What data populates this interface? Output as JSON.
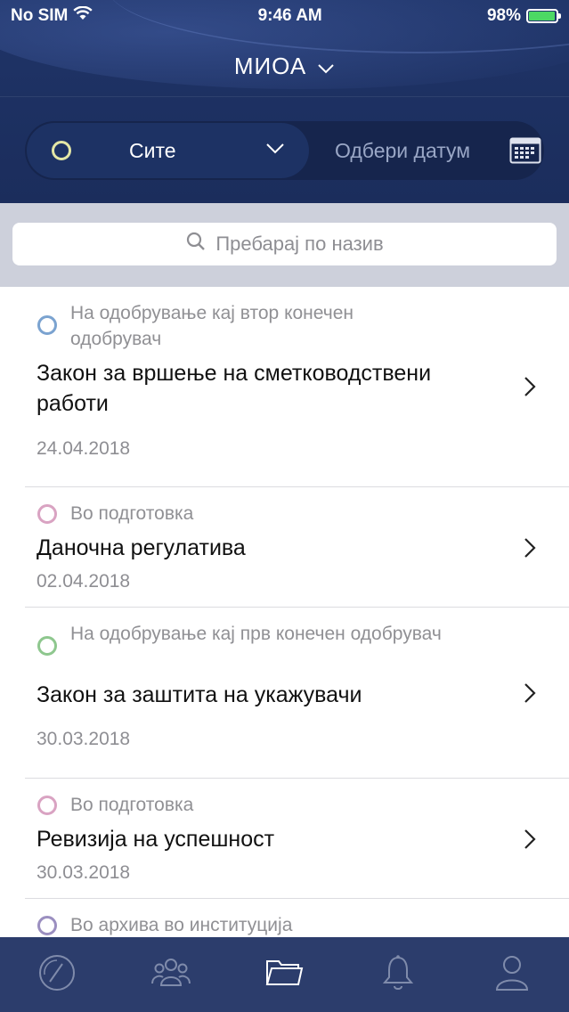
{
  "status_bar": {
    "carrier": "No SIM",
    "time": "9:46 AM",
    "battery": "98%",
    "battery_level": 0.98
  },
  "header": {
    "title": "МИОА"
  },
  "filter": {
    "status_label": "Сите",
    "date_label": "Одбери датум"
  },
  "search": {
    "placeholder": "Пребарај по назив"
  },
  "colors": {
    "header_bg": "#1f3468",
    "tabbar_bg": "#2c3d6c",
    "status_blue": "#7ba3d0",
    "status_pink": "#d9a3c2",
    "status_green": "#8ec78e",
    "status_purple": "#9b8fc0",
    "filter_ring": "#e3e6a6"
  },
  "items": [
    {
      "status": "На одобрување кај втор конечен одобрувач",
      "title": "Закон за вршење на сметководствени работи",
      "date": "24.04.2018"
    },
    {
      "status": "Во подготовка",
      "title": "Даночна регулатива",
      "date": "02.04.2018"
    },
    {
      "status": "На одобрување кај прв конечен одобрувач",
      "title": "Закон за заштита на укажувачи",
      "date": "30.03.2018"
    },
    {
      "status": "Во подготовка",
      "title": "Ревизија на успешност",
      "date": "30.03.2018"
    },
    {
      "status": "Во архива во институција"
    }
  ],
  "tabbar": {
    "tabs": [
      "dashboard-icon",
      "users-icon",
      "folder-icon",
      "bell-icon",
      "profile-icon"
    ]
  }
}
